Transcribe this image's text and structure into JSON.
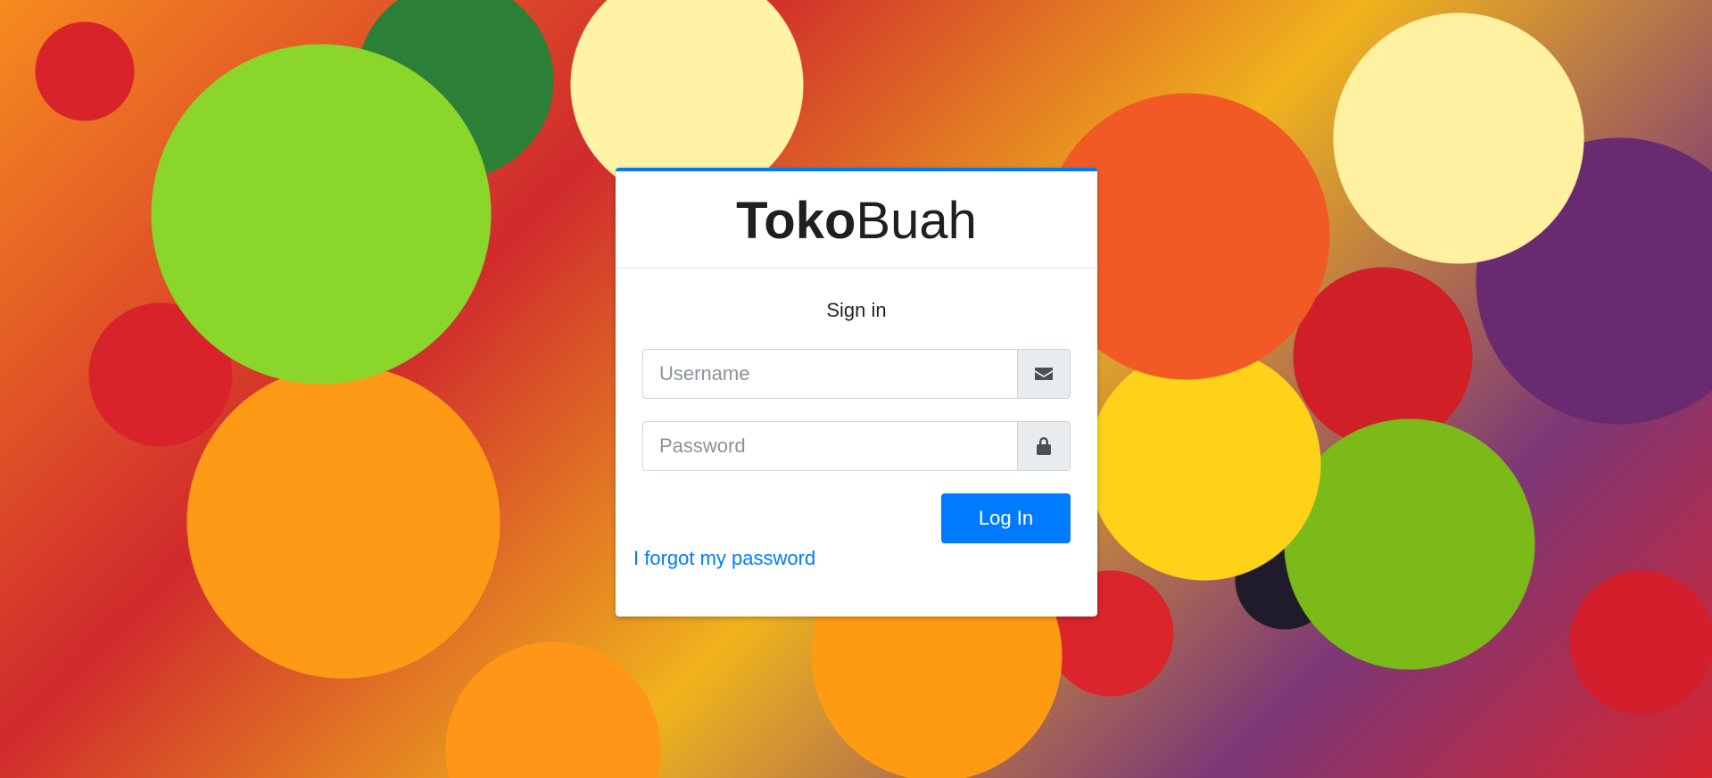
{
  "brand": {
    "bold": "Toko",
    "light": "Buah"
  },
  "login": {
    "message": "Sign in",
    "username_placeholder": "Username",
    "password_placeholder": "Password",
    "submit_label": "Log In",
    "forgot_link": "I forgot my password"
  },
  "icons": {
    "username": "envelope-icon",
    "password": "lock-icon"
  },
  "colors": {
    "accent": "#007bff",
    "card_background": "#ffffff",
    "addon_background": "#e9ecef"
  }
}
